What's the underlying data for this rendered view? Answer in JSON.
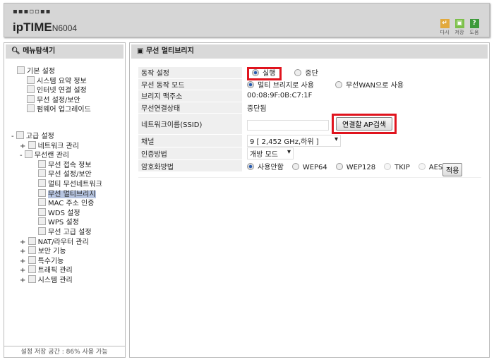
{
  "header": {
    "brand_dots": "▪▪▪▫▫▪▪",
    "brand": "ipTIME",
    "model": "N6004",
    "toolbar": [
      {
        "label": "다시",
        "icon": "refresh-icon",
        "color": "#e2a93c"
      },
      {
        "label": "저장",
        "icon": "save-icon",
        "color": "#7cc04a"
      },
      {
        "label": "도움",
        "icon": "help-icon",
        "color": "#3d9a3a"
      }
    ]
  },
  "sidebar": {
    "title": "메뉴탐색기",
    "basic": {
      "label": "기본 설정",
      "items": [
        "시스템 요약 정보",
        "인터넷 연결 설정",
        "무선 설정/보안",
        "펌웨어 업그레이드"
      ]
    },
    "advanced": {
      "label": "고급 설정",
      "items": [
        {
          "label": "네트워크 관리",
          "toggle": "+"
        },
        {
          "label": "무선랜 관리",
          "toggle": "-",
          "children": [
            "무선 접속 정보",
            "무선 설정/보안",
            "멀티 무선네트워크",
            "무선 멀티브리지",
            "MAC 주소 인증",
            "WDS 설정",
            "WPS 설정",
            "무선 고급 설정"
          ]
        },
        {
          "label": "NAT/라우터 관리",
          "toggle": "+"
        },
        {
          "label": "보안 기능",
          "toggle": "+"
        },
        {
          "label": "특수기능",
          "toggle": "+"
        },
        {
          "label": "트래픽 관리",
          "toggle": "+"
        },
        {
          "label": "시스템 관리",
          "toggle": "+"
        }
      ]
    },
    "storage": "설정 저장 공간 : 86% 사용 가능"
  },
  "main": {
    "title": "무선 멀티브리지",
    "rows": {
      "op_label": "동작 설정",
      "op_on": "실행",
      "op_off": "중단",
      "mode_label": "무선 동작 모드",
      "mode_bridge": "멀티 브리지로 사용",
      "mode_wan": "무선WAN으로 사용",
      "mac_label": "브리지 맥주소",
      "mac": "00:08:9F:0B:C7:1F",
      "status_label": "무선연결상태",
      "status": "중단됨",
      "ssid_label": "네트워크이름(SSID)",
      "ssid": "",
      "search_btn": "연결할 AP검색",
      "channel_label": "채널",
      "channel": "9  [ 2,452 GHz,하위 ]",
      "auth_label": "인증방법",
      "auth": "개방 모드",
      "enc_label": "암호화방법",
      "enc": [
        "사용안함",
        "WEP64",
        "WEP128",
        "TKIP",
        "AES"
      ]
    },
    "apply": "적용"
  }
}
